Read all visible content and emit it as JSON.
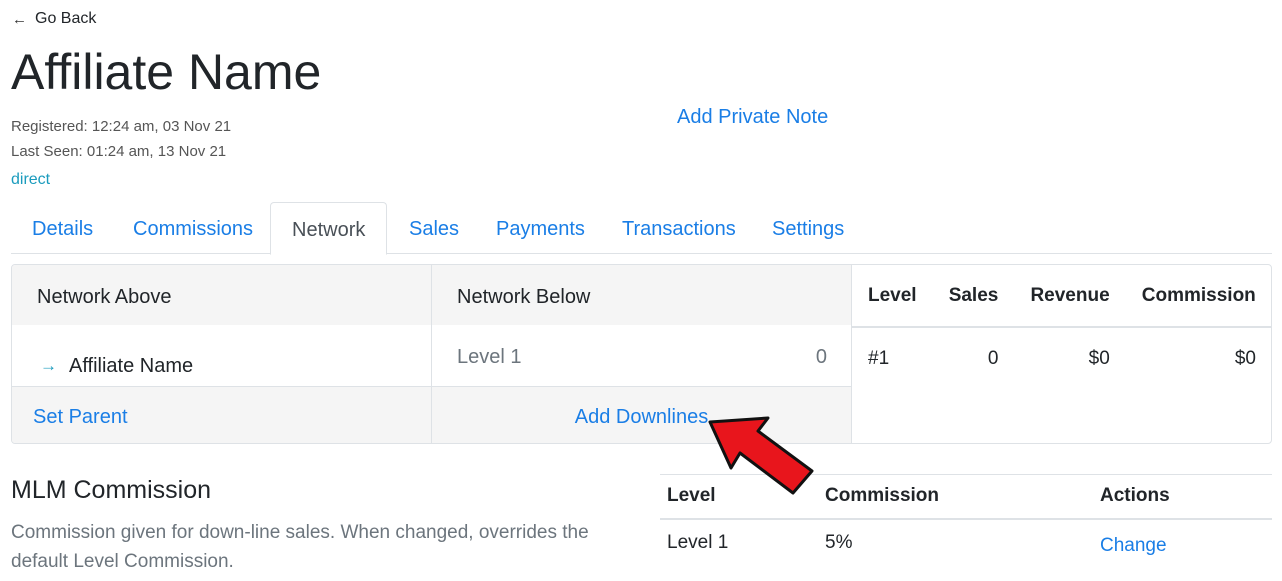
{
  "header": {
    "go_back": "Go Back",
    "title": "Affiliate Name",
    "registered": "Registered: 12:24 am, 03 Nov 21",
    "last_seen": "Last Seen: 01:24 am, 13 Nov 21",
    "source": "direct",
    "private_note": "Add Private Note"
  },
  "tabs": [
    {
      "label": "Details"
    },
    {
      "label": "Commissions"
    },
    {
      "label": "Network",
      "active": true
    },
    {
      "label": "Sales"
    },
    {
      "label": "Payments"
    },
    {
      "label": "Transactions"
    },
    {
      "label": "Settings"
    }
  ],
  "network": {
    "above_header": "Network Above",
    "below_header": "Network Below",
    "above_item": "Affiliate Name",
    "below_level": "Level 1",
    "below_count": "0",
    "set_parent": "Set Parent",
    "add_downlines": "Add Downlines"
  },
  "stats": {
    "headers": [
      "Level",
      "Sales",
      "Revenue",
      "Commission"
    ],
    "row": [
      "#1",
      "0",
      "$0",
      "$0"
    ]
  },
  "mlm": {
    "title": "MLM Commission",
    "description": "Commission given for down-line sales. When changed, overrides the default Level Commission.",
    "headers": [
      "Level",
      "Commission",
      "Actions"
    ],
    "row": {
      "level": "Level 1",
      "commission": "5%",
      "action": "Change"
    }
  },
  "colors": {
    "link": "#1a7ee6",
    "annotation_arrow": "#e8151c"
  }
}
